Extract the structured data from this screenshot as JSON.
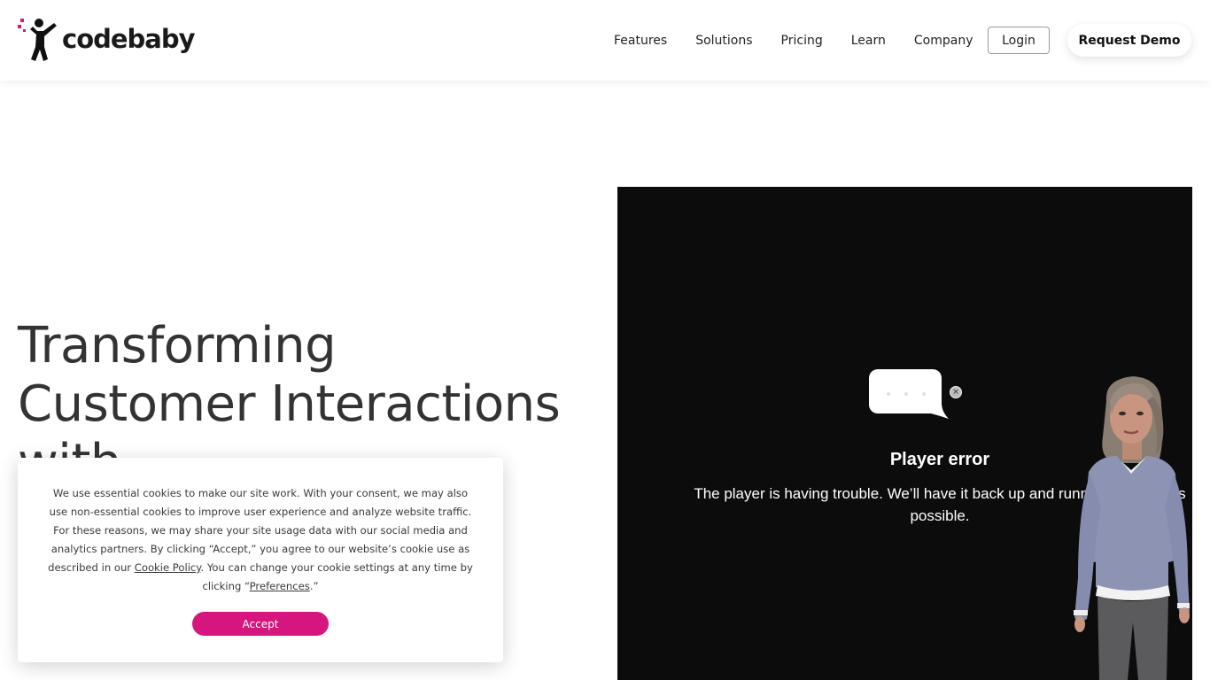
{
  "header": {
    "logo_text": "codebaby",
    "nav": [
      {
        "label": "Features"
      },
      {
        "label": "Solutions"
      },
      {
        "label": "Pricing"
      },
      {
        "label": "Learn"
      },
      {
        "label": "Company"
      }
    ],
    "login_label": "Login",
    "demo_label": "Request Demo"
  },
  "hero": {
    "title_line1": "Transforming",
    "title_line2": "Customer Interactions",
    "title_line3": "with"
  },
  "player": {
    "error_title": "Player error",
    "error_message_line1": "The player is having trouble. We’ll have it back up and running as soon as",
    "error_message_line2": "possible.",
    "close_icon_glyph": "×"
  },
  "cookie": {
    "text_before_link": "We use essential cookies to make our site work. With your consent, we may also use non-essential cookies to improve user experience and analyze website traffic. For these reasons, we may share your site usage data with our social media and analytics partners. By clicking “Accept,” you agree to our website’s cookie use as described in our ",
    "cookie_policy_link": "Cookie Policy",
    "text_middle": ". You can change your cookie settings at any time by clicking “",
    "preferences_link": "Preferences",
    "text_end": ".”",
    "accept_label": "Accept"
  },
  "colors": {
    "brand_pink": "#d6157f",
    "player_bg": "#0c0c0c",
    "text_dark": "#333333"
  }
}
